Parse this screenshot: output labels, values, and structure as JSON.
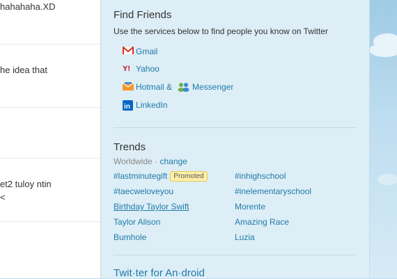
{
  "timeline": {
    "tweets": [
      {
        "text": "hahahaha.XD"
      },
      {
        "text": "he idea that"
      },
      {
        "text": ""
      },
      {
        "text": "et2 tuloy ntin",
        "text2": "<"
      },
      {
        "text": ""
      }
    ]
  },
  "find_friends": {
    "title": "Find Friends",
    "subtitle": "Use the services below to find people you know on Twitter",
    "services": {
      "gmail": "Gmail",
      "yahoo": "Yahoo",
      "hotmail": "Hotmail &",
      "messenger": "Messenger",
      "linkedin": "LinkedIn"
    }
  },
  "trends": {
    "title": "Trends",
    "location": "Worldwide",
    "separator": "·",
    "change_label": "change",
    "promoted_label": "Promoted",
    "left": [
      "#lastminutegift",
      "#taecweloveyou",
      "Birthday Taylor Swift",
      "Taylor Alison",
      "Bumhole"
    ],
    "right": [
      "#inhighschool",
      "#inelementaryschool",
      "Morente",
      "Amazing Race",
      "Luzia"
    ]
  },
  "android": {
    "title": "Twit·ter for An·droid"
  },
  "colors": {
    "link": "#1f7aa8",
    "dashboard_bg": "#ddeef6",
    "promoted_bg": "#fff0a8"
  }
}
